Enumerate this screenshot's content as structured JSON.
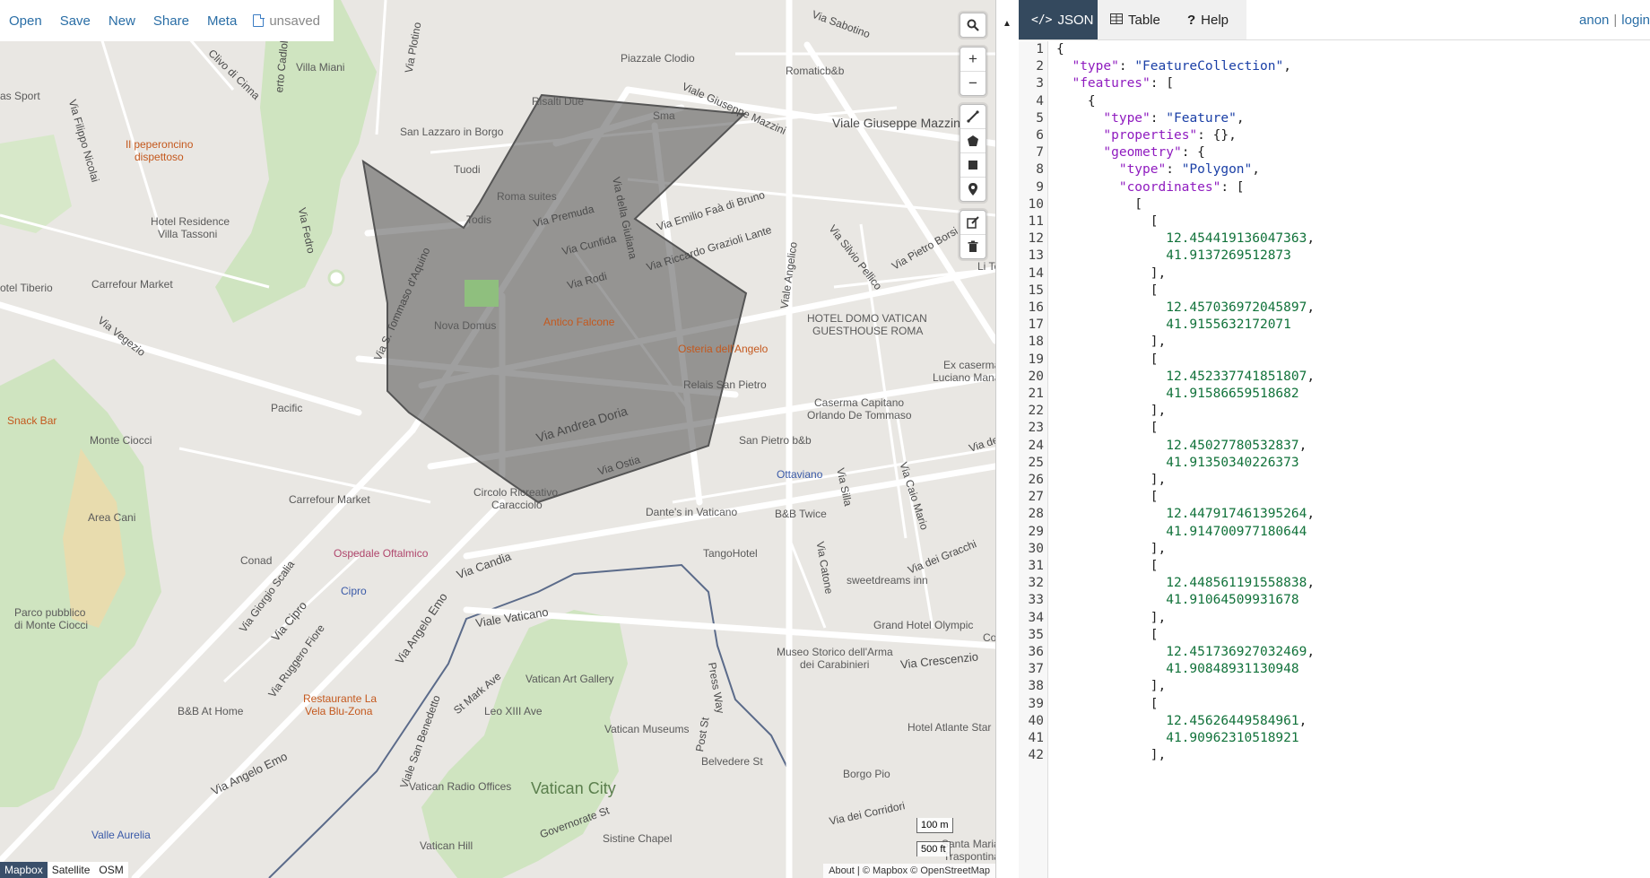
{
  "topmenu": {
    "open": "Open",
    "save": "Save",
    "new": "New",
    "share": "Share",
    "meta": "Meta",
    "status": "unsaved"
  },
  "map_controls": {
    "search_icon": "search-icon",
    "zoom_in": "+",
    "zoom_out": "−",
    "draw_line_icon": "draw-line-icon",
    "draw_polygon_icon": "draw-polygon-icon",
    "draw_rectangle_icon": "draw-rectangle-icon",
    "draw_marker_icon": "draw-marker-icon",
    "edit_icon": "edit-icon",
    "delete_icon": "trash-icon"
  },
  "map_labels": {
    "villa_miani": "Villa Miani",
    "piazzale_clodio": "Piazzale Clodio",
    "romaticb_b": "Romaticb&b",
    "viale_giuseppe_mazzini": "Viale Giuseppe Mazzini",
    "viale_giuseppe_mazzini_diag": "Viale Giuseppe Mazzini",
    "risalti_due": "Risalti Due",
    "sma": "Sma",
    "san_lazzaro": "San Lazzaro in Borgo",
    "tuodi": "Tuodi",
    "il_peperoncino": "Il peperoncino",
    "dispettoso": "dispettoso",
    "roma_suites": "Roma suites",
    "todis": "Todis",
    "via_premuda": "Via Premuda",
    "via_emilio": "Via Emilio Faà di Bruno",
    "via_cunfida": "Via Cunfida",
    "via_riccardo": "Via Riccardo Grazioli Lante",
    "via_della_giuliana": "Via della Giuliana",
    "hotel_residence": "Hotel Residence",
    "villa_tassoni": "Villa Tassoni",
    "carrefour_market": "Carrefour Market",
    "hotel_tiberio": "otel Tiberio",
    "via_rodi": "Via Rodi",
    "antico_falcone": "Antico Falcone",
    "nova_domus": "Nova Domus",
    "via_tommaso": "Via S. Tommaso d'Aquino",
    "osteria": "Osteria dell'Angelo",
    "relais": "Relais San Pietro",
    "hotel_domo": "HOTEL DOMO VATICAN",
    "guesthouse": "GUESTHOUSE ROMA",
    "ex_caserma": "Ex caserma",
    "luciano_mana": "Luciano Mana",
    "via_vegezio": "Via Vegezio",
    "pacific": "Pacific",
    "snack_bar": "Snack Bar",
    "monte_ciocci": "Monte Ciocci",
    "via_andrea_doria": "Via Andrea Doria",
    "via_ostia": "Via Ostia",
    "caserma": "Caserma Capitano",
    "orlando": "Orlando De Tommaso",
    "san_pietro_bb": "San Pietro b&b",
    "ottaviano": "Ottaviano",
    "circolo": "Circolo Ricreativo",
    "caracciolo": "Caracciolo",
    "carrefour_market2": "Carrefour Market",
    "dantes": "Dante's in Vaticano",
    "bb_twice": "B&B Twice",
    "area_cani": "Area Cani",
    "tangohotel": "TangoHotel",
    "conad": "Conad",
    "ospedale": "Ospedale Oftalmico",
    "via_candia": "Via Candia",
    "cipro": "Cipro",
    "sweetdreams": "sweetdreams inn",
    "via_dei_gracchi": "Via dei Gracchi",
    "parco": "Parco pubblico",
    "di_monte_ciocci": "di Monte Ciocci",
    "via_cipro": "Via Cipro",
    "via_giorgio_scalia": "Via Giorgio Scalia",
    "viale_vaticano": "Viale Vaticano",
    "grand_hotel": "Grand Hotel Olympic",
    "museo": "Museo Storico dell'Arma",
    "carabinieri": "dei Carabinieri",
    "via_crescenzio": "Via Crescenzio",
    "vatican_art_gallery": "Vatican Art Gallery",
    "via_angelo_emo": "Via Angelo Emo",
    "via_ruggero_fiore": "Via Ruggero Fiore",
    "leo_xiii": "Leo XIII Ave",
    "st_mark": "St Mark Ave",
    "press_way": "Press Way",
    "vatican_museums": "Vatican Museums",
    "restaurante": "Restaurante La",
    "vela_blu": "Vela Blu-Zona",
    "bb_at_home": "B&B At Home",
    "hotel_atlante": "Hotel Atlante Star",
    "post_st": "Post St",
    "belvedere": "Belvedere St",
    "borgo_pio": "Borgo Pio",
    "via_angelo_emo2": "Via Angelo Emo",
    "viale_san_benedetto": "Viale San Benedetto",
    "vatican_radio": "Vatican Radio Offices",
    "vatican_city": "Vatican City",
    "via_dei_corridori": "Via dei Corridori",
    "valle_aurelia": "Valle Aurelia",
    "vatican_hill": "Vatican Hill",
    "governorate": "Governorate St",
    "sistine": "Sistine Chapel",
    "via_filippo": "Via Filippo Nicolai",
    "clivo_cinna": "Clivo di Cinna",
    "via_fedro": "Via Fedro",
    "via_plotino": "Via Plotino",
    "via_sabotino": "Via Sabotino",
    "via_angelico": "Viale Angelico",
    "via_silvio_pellico": "Via Silvio Pellico",
    "via_pietro_borsi": "Via Pietro Borsi",
    "via_silla": "Via Silla",
    "via_caio_mario": "Via Caio Mario",
    "via_catone": "Via Catone",
    "as_sport": "as Sport",
    "erto_cadolo": "erto Cadlolo",
    "via_de": "Via de",
    "li_ter": "Li Tere",
    "co": "Co",
    "santa_maria": "Santa Maria",
    "traspontina": "Traspontina"
  },
  "layers": {
    "mapbox": "Mapbox",
    "satellite": "Satellite",
    "osm": "OSM"
  },
  "scale": {
    "metric": "100 m",
    "imperial": "500 ft"
  },
  "attribution": "About | © Mapbox © OpenStreetMap",
  "tabs": {
    "json": "JSON",
    "table": "Table",
    "help": "Help"
  },
  "auth": {
    "anon": "anon",
    "sep": "|",
    "login": "login"
  },
  "geojson_lines": [
    "{",
    "  \"type\": \"FeatureCollection\",",
    "  \"features\": [",
    "    {",
    "      \"type\": \"Feature\",",
    "      \"properties\": {},",
    "      \"geometry\": {",
    "        \"type\": \"Polygon\",",
    "        \"coordinates\": [",
    "          [",
    "            [",
    "              12.454419136047363,",
    "              41.9137269512873",
    "            ],",
    "            [",
    "              12.457036972045897,",
    "              41.9155632172071",
    "            ],",
    "            [",
    "              12.452337741851807,",
    "              41.91586659518682",
    "            ],",
    "            [",
    "              12.45027780532837,",
    "              41.91350340226373",
    "            ],",
    "            [",
    "              12.447917461395264,",
    "              41.914700977180644",
    "            ],",
    "            [",
    "              12.448561191558838,",
    "              41.91064509931678",
    "            ],",
    "            [",
    "              12.451736927032469,",
    "              41.90848931130948",
    "            ],",
    "            [",
    "              12.45626449584961,",
    "              41.90962310518921",
    "            ],"
  ]
}
